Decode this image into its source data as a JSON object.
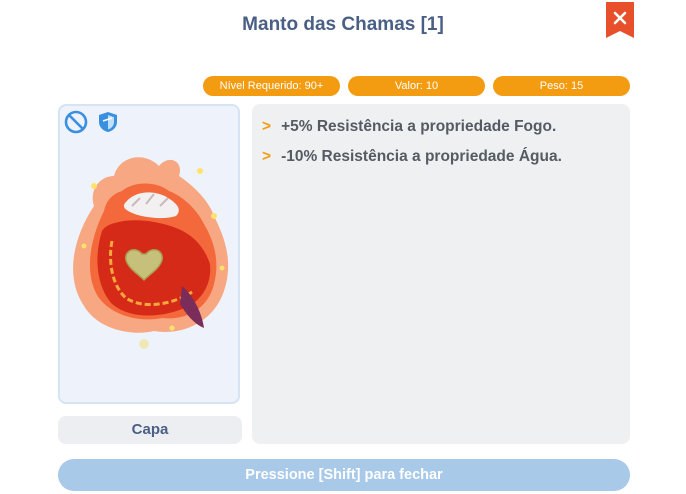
{
  "window": {
    "title": "Manto das Chamas [1]"
  },
  "stats": {
    "level": "Nível Requerido: 90+",
    "value": "Valor: 10",
    "weight": "Peso: 15"
  },
  "item": {
    "name": "Capa",
    "icons": [
      "no-trade-icon",
      "shield-icon"
    ]
  },
  "description": [
    {
      "bullet": ">",
      "text": "+5% Resistência a propriedade Fogo."
    },
    {
      "bullet": ">",
      "text": "-10% Resistência a propriedade Água."
    }
  ],
  "footer": {
    "close_hint": "Pressione [Shift] para fechar"
  },
  "colors": {
    "title": "#4a5f86",
    "accent": "#f39c12",
    "close_button": "#e8502b",
    "footer_button": "#a9c9e9"
  }
}
